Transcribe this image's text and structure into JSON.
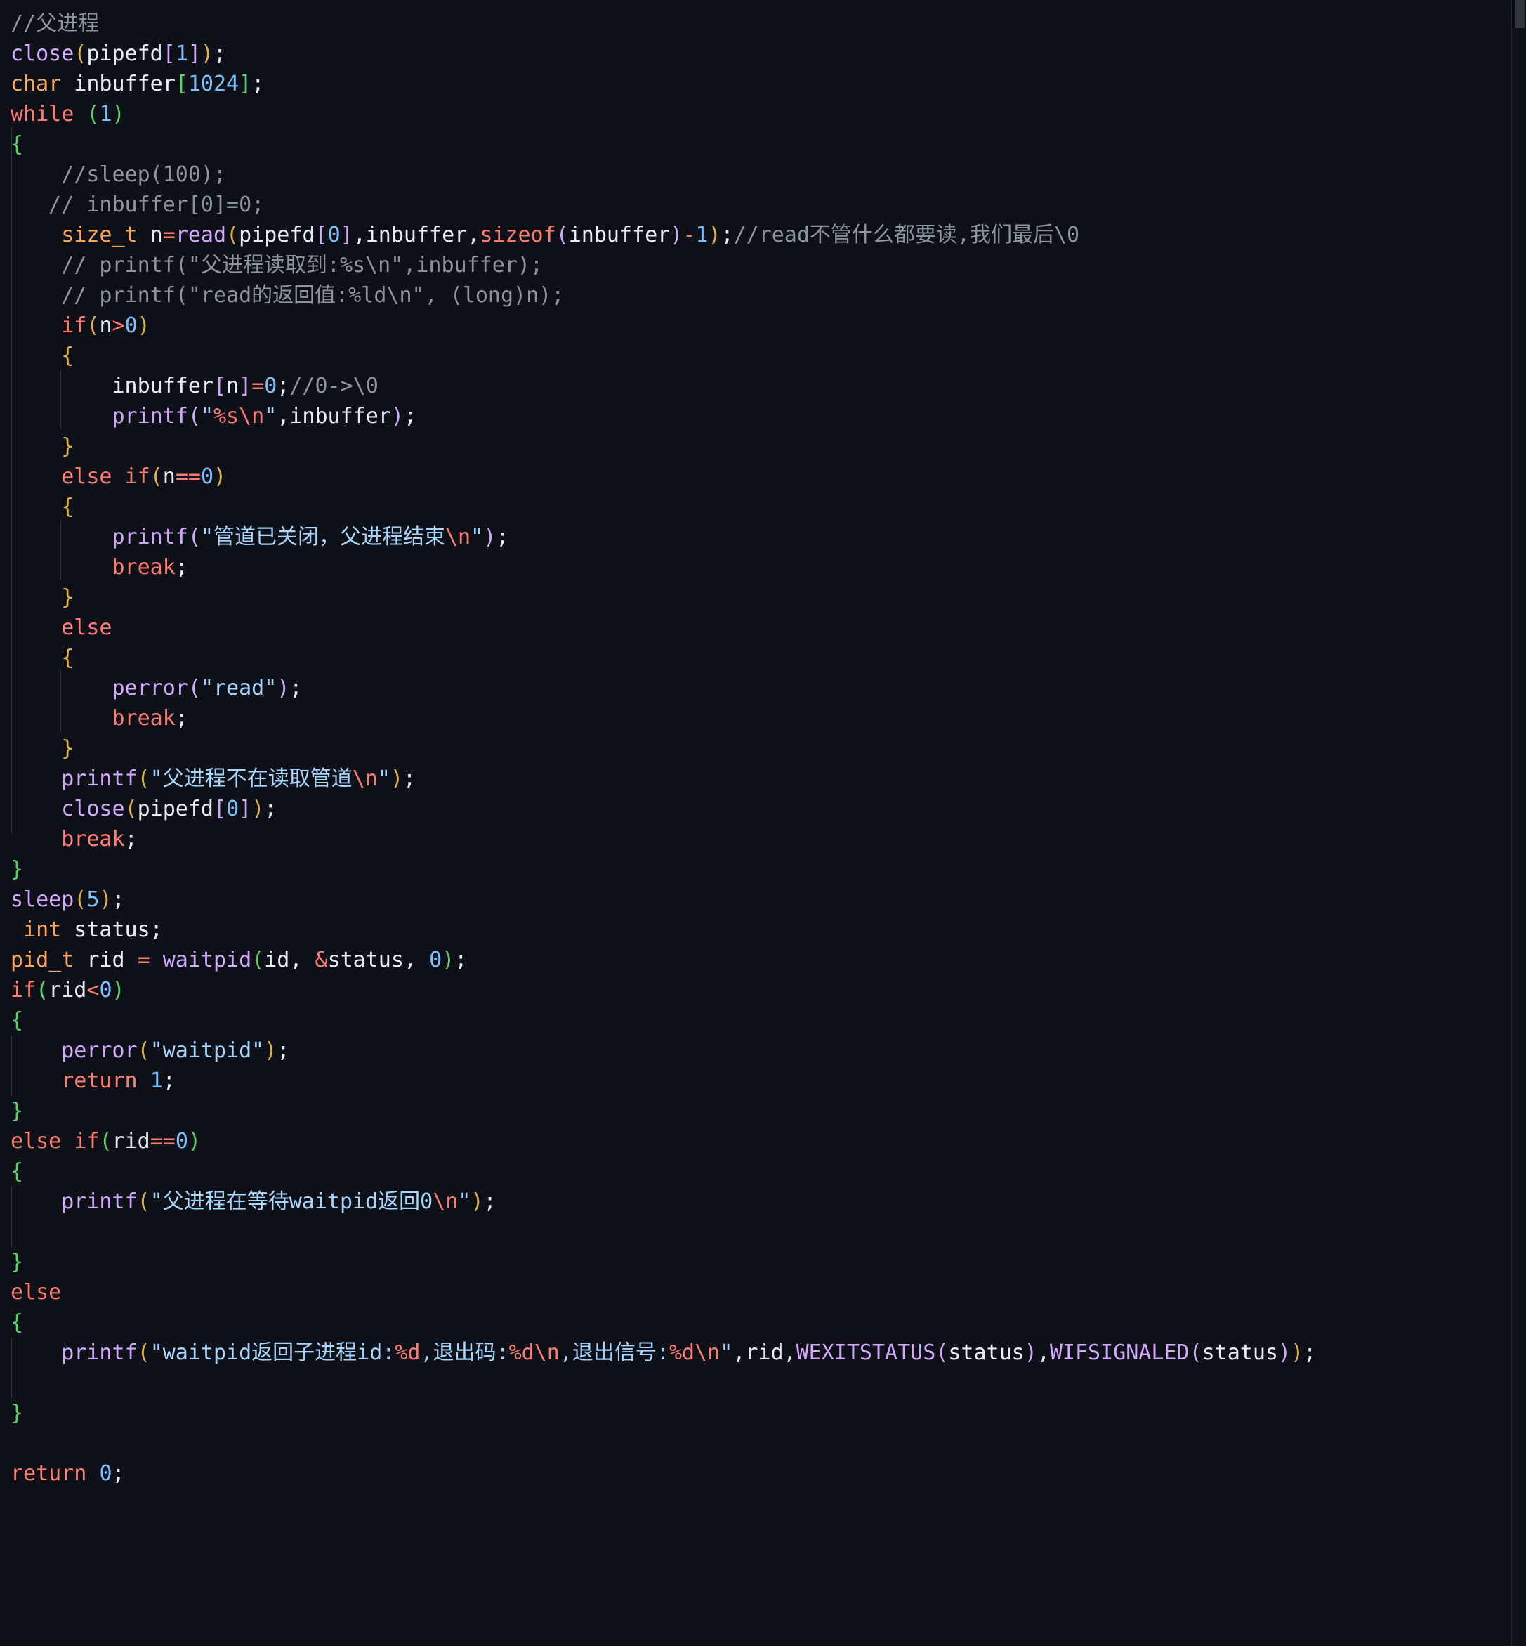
{
  "editor": {
    "language": "c",
    "lines": [
      [
        {
          "t": "//父进程",
          "c": "c"
        }
      ],
      [
        {
          "t": "close",
          "c": "f"
        },
        {
          "t": "(",
          "c": "p1"
        },
        {
          "t": "pipefd",
          "c": "v"
        },
        {
          "t": "[",
          "c": "p2"
        },
        {
          "t": "1",
          "c": "n"
        },
        {
          "t": "]",
          "c": "p2"
        },
        {
          "t": ")",
          "c": "p1"
        },
        {
          "t": ";",
          "c": "v"
        }
      ],
      [
        {
          "t": "char",
          "c": "t"
        },
        {
          "t": " inbuffer",
          "c": "v"
        },
        {
          "t": "[",
          "c": "pg"
        },
        {
          "t": "1024",
          "c": "n"
        },
        {
          "t": "]",
          "c": "pg"
        },
        {
          "t": ";",
          "c": "v"
        }
      ],
      [
        {
          "t": "while",
          "c": "k"
        },
        {
          "t": " ",
          "c": "v"
        },
        {
          "t": "(",
          "c": "pg"
        },
        {
          "t": "1",
          "c": "n"
        },
        {
          "t": ")",
          "c": "pg"
        }
      ],
      [
        {
          "t": "{",
          "c": "pg"
        }
      ],
      [
        {
          "t": "    //sleep(100);",
          "c": "c"
        }
      ],
      [
        {
          "t": "   // inbuffer[0]=0;",
          "c": "c"
        }
      ],
      [
        {
          "t": "    ",
          "c": "v"
        },
        {
          "t": "size_t",
          "c": "t"
        },
        {
          "t": " n",
          "c": "v"
        },
        {
          "t": "=",
          "c": "o"
        },
        {
          "t": "read",
          "c": "f"
        },
        {
          "t": "(",
          "c": "p1"
        },
        {
          "t": "pipefd",
          "c": "v"
        },
        {
          "t": "[",
          "c": "p2"
        },
        {
          "t": "0",
          "c": "n"
        },
        {
          "t": "]",
          "c": "p2"
        },
        {
          "t": ",inbuffer,",
          "c": "v"
        },
        {
          "t": "sizeof",
          "c": "k"
        },
        {
          "t": "(",
          "c": "p2"
        },
        {
          "t": "inbuffer",
          "c": "v"
        },
        {
          "t": ")",
          "c": "p2"
        },
        {
          "t": "-",
          "c": "o"
        },
        {
          "t": "1",
          "c": "n"
        },
        {
          "t": ")",
          "c": "p1"
        },
        {
          "t": ";",
          "c": "v"
        },
        {
          "t": "//read不管什么都要读,我们最后\\0",
          "c": "c"
        }
      ],
      [
        {
          "t": "    // printf(\"父进程读取到:%s\\n\",inbuffer);",
          "c": "c"
        }
      ],
      [
        {
          "t": "    // printf(\"read的返回值:%ld\\n\", (long)n);",
          "c": "c"
        }
      ],
      [
        {
          "t": "    ",
          "c": "v"
        },
        {
          "t": "if",
          "c": "k"
        },
        {
          "t": "(",
          "c": "p1"
        },
        {
          "t": "n",
          "c": "v"
        },
        {
          "t": ">",
          "c": "o"
        },
        {
          "t": "0",
          "c": "n"
        },
        {
          "t": ")",
          "c": "p1"
        }
      ],
      [
        {
          "t": "    ",
          "c": "v"
        },
        {
          "t": "{",
          "c": "p1"
        }
      ],
      [
        {
          "t": "        inbuffer",
          "c": "v"
        },
        {
          "t": "[",
          "c": "p2"
        },
        {
          "t": "n",
          "c": "v"
        },
        {
          "t": "]",
          "c": "p2"
        },
        {
          "t": "=",
          "c": "o"
        },
        {
          "t": "0",
          "c": "n"
        },
        {
          "t": ";",
          "c": "v"
        },
        {
          "t": "//0->\\0",
          "c": "c"
        }
      ],
      [
        {
          "t": "        ",
          "c": "v"
        },
        {
          "t": "printf",
          "c": "f"
        },
        {
          "t": "(",
          "c": "p2"
        },
        {
          "t": "\"",
          "c": "s"
        },
        {
          "t": "%s\\n",
          "c": "e"
        },
        {
          "t": "\"",
          "c": "s"
        },
        {
          "t": ",inbuffer",
          "c": "v"
        },
        {
          "t": ")",
          "c": "p2"
        },
        {
          "t": ";",
          "c": "v"
        }
      ],
      [
        {
          "t": "    ",
          "c": "v"
        },
        {
          "t": "}",
          "c": "p1"
        }
      ],
      [
        {
          "t": "    ",
          "c": "v"
        },
        {
          "t": "else",
          "c": "k"
        },
        {
          "t": " ",
          "c": "v"
        },
        {
          "t": "if",
          "c": "k"
        },
        {
          "t": "(",
          "c": "p1"
        },
        {
          "t": "n",
          "c": "v"
        },
        {
          "t": "==",
          "c": "o"
        },
        {
          "t": "0",
          "c": "n"
        },
        {
          "t": ")",
          "c": "p1"
        }
      ],
      [
        {
          "t": "    ",
          "c": "v"
        },
        {
          "t": "{",
          "c": "p1"
        }
      ],
      [
        {
          "t": "        ",
          "c": "v"
        },
        {
          "t": "printf",
          "c": "f"
        },
        {
          "t": "(",
          "c": "p2"
        },
        {
          "t": "\"管道已关闭，父进程结束",
          "c": "s"
        },
        {
          "t": "\\n",
          "c": "e"
        },
        {
          "t": "\"",
          "c": "s"
        },
        {
          "t": ")",
          "c": "p2"
        },
        {
          "t": ";",
          "c": "v"
        }
      ],
      [
        {
          "t": "        ",
          "c": "v"
        },
        {
          "t": "break",
          "c": "k"
        },
        {
          "t": ";",
          "c": "v"
        }
      ],
      [
        {
          "t": "    ",
          "c": "v"
        },
        {
          "t": "}",
          "c": "p1"
        }
      ],
      [
        {
          "t": "    ",
          "c": "v"
        },
        {
          "t": "else",
          "c": "k"
        }
      ],
      [
        {
          "t": "    ",
          "c": "v"
        },
        {
          "t": "{",
          "c": "p1"
        }
      ],
      [
        {
          "t": "        ",
          "c": "v"
        },
        {
          "t": "perror",
          "c": "f"
        },
        {
          "t": "(",
          "c": "p2"
        },
        {
          "t": "\"read\"",
          "c": "s"
        },
        {
          "t": ")",
          "c": "p2"
        },
        {
          "t": ";",
          "c": "v"
        }
      ],
      [
        {
          "t": "        ",
          "c": "v"
        },
        {
          "t": "break",
          "c": "k"
        },
        {
          "t": ";",
          "c": "v"
        }
      ],
      [
        {
          "t": "    ",
          "c": "v"
        },
        {
          "t": "}",
          "c": "p1"
        }
      ],
      [
        {
          "t": "    ",
          "c": "v"
        },
        {
          "t": "printf",
          "c": "f"
        },
        {
          "t": "(",
          "c": "p1"
        },
        {
          "t": "\"父进程不在读取管道",
          "c": "s"
        },
        {
          "t": "\\n",
          "c": "e"
        },
        {
          "t": "\"",
          "c": "s"
        },
        {
          "t": ")",
          "c": "p1"
        },
        {
          "t": ";",
          "c": "v"
        }
      ],
      [
        {
          "t": "    ",
          "c": "v"
        },
        {
          "t": "close",
          "c": "f"
        },
        {
          "t": "(",
          "c": "p1"
        },
        {
          "t": "pipefd",
          "c": "v"
        },
        {
          "t": "[",
          "c": "p2"
        },
        {
          "t": "0",
          "c": "n"
        },
        {
          "t": "]",
          "c": "p2"
        },
        {
          "t": ")",
          "c": "p1"
        },
        {
          "t": ";",
          "c": "v"
        }
      ],
      [
        {
          "t": "    ",
          "c": "v"
        },
        {
          "t": "break",
          "c": "k"
        },
        {
          "t": ";",
          "c": "v"
        }
      ],
      [
        {
          "t": "}",
          "c": "pg"
        }
      ],
      [
        {
          "t": "sleep",
          "c": "f"
        },
        {
          "t": "(",
          "c": "p1"
        },
        {
          "t": "5",
          "c": "n"
        },
        {
          "t": ")",
          "c": "p1"
        },
        {
          "t": ";",
          "c": "v"
        }
      ],
      [
        {
          "t": " ",
          "c": "v"
        },
        {
          "t": "int",
          "c": "t"
        },
        {
          "t": " status;",
          "c": "v"
        }
      ],
      [
        {
          "t": "pid_t",
          "c": "t"
        },
        {
          "t": " rid ",
          "c": "v"
        },
        {
          "t": "=",
          "c": "o"
        },
        {
          "t": " ",
          "c": "v"
        },
        {
          "t": "waitpid",
          "c": "f"
        },
        {
          "t": "(",
          "c": "pg"
        },
        {
          "t": "id, ",
          "c": "v"
        },
        {
          "t": "&",
          "c": "o"
        },
        {
          "t": "status, ",
          "c": "v"
        },
        {
          "t": "0",
          "c": "n"
        },
        {
          "t": ")",
          "c": "pg"
        },
        {
          "t": ";",
          "c": "v"
        }
      ],
      [
        {
          "t": "if",
          "c": "k"
        },
        {
          "t": "(",
          "c": "pg"
        },
        {
          "t": "rid",
          "c": "v"
        },
        {
          "t": "<",
          "c": "o"
        },
        {
          "t": "0",
          "c": "n"
        },
        {
          "t": ")",
          "c": "pg"
        }
      ],
      [
        {
          "t": "{",
          "c": "pg"
        }
      ],
      [
        {
          "t": "    ",
          "c": "v"
        },
        {
          "t": "perror",
          "c": "f"
        },
        {
          "t": "(",
          "c": "p1"
        },
        {
          "t": "\"waitpid\"",
          "c": "s"
        },
        {
          "t": ")",
          "c": "p1"
        },
        {
          "t": ";",
          "c": "v"
        }
      ],
      [
        {
          "t": "    ",
          "c": "v"
        },
        {
          "t": "return",
          "c": "k"
        },
        {
          "t": " ",
          "c": "v"
        },
        {
          "t": "1",
          "c": "n"
        },
        {
          "t": ";",
          "c": "v"
        }
      ],
      [
        {
          "t": "}",
          "c": "pg"
        }
      ],
      [
        {
          "t": "else",
          "c": "k"
        },
        {
          "t": " ",
          "c": "v"
        },
        {
          "t": "if",
          "c": "k"
        },
        {
          "t": "(",
          "c": "pg"
        },
        {
          "t": "rid",
          "c": "v"
        },
        {
          "t": "==",
          "c": "o"
        },
        {
          "t": "0",
          "c": "n"
        },
        {
          "t": ")",
          "c": "pg"
        }
      ],
      [
        {
          "t": "{",
          "c": "pg"
        }
      ],
      [
        {
          "t": "    ",
          "c": "v"
        },
        {
          "t": "printf",
          "c": "f"
        },
        {
          "t": "(",
          "c": "p1"
        },
        {
          "t": "\"父进程在等待waitpid返回0",
          "c": "s"
        },
        {
          "t": "\\n",
          "c": "e"
        },
        {
          "t": "\"",
          "c": "s"
        },
        {
          "t": ")",
          "c": "p1"
        },
        {
          "t": ";",
          "c": "v"
        }
      ],
      [
        {
          "t": "",
          "c": "v"
        }
      ],
      [
        {
          "t": "}",
          "c": "pg"
        }
      ],
      [
        {
          "t": "else",
          "c": "k"
        }
      ],
      [
        {
          "t": "{",
          "c": "pg"
        }
      ],
      [
        {
          "t": "    ",
          "c": "v"
        },
        {
          "t": "printf",
          "c": "f"
        },
        {
          "t": "(",
          "c": "p1"
        },
        {
          "t": "\"waitpid返回子进程id:",
          "c": "s"
        },
        {
          "t": "%d",
          "c": "e"
        },
        {
          "t": ",退出码:",
          "c": "s"
        },
        {
          "t": "%d\\n",
          "c": "e"
        },
        {
          "t": ",退出信号:",
          "c": "s"
        },
        {
          "t": "%d\\n",
          "c": "e"
        },
        {
          "t": "\"",
          "c": "s"
        },
        {
          "t": ",rid,",
          "c": "v"
        },
        {
          "t": "WEXITSTATUS",
          "c": "m"
        },
        {
          "t": "(",
          "c": "p2"
        },
        {
          "t": "status",
          "c": "v"
        },
        {
          "t": ")",
          "c": "p2"
        },
        {
          "t": ",",
          "c": "v"
        },
        {
          "t": "WIFSIGNALED",
          "c": "m"
        },
        {
          "t": "(",
          "c": "p2"
        },
        {
          "t": "status",
          "c": "v"
        },
        {
          "t": ")",
          "c": "p2"
        },
        {
          "t": ")",
          "c": "p1"
        },
        {
          "t": ";",
          "c": "v"
        }
      ],
      [
        {
          "t": "",
          "c": "v"
        }
      ],
      [
        {
          "t": "}",
          "c": "pg"
        }
      ],
      [
        {
          "t": "",
          "c": "v"
        }
      ],
      [
        {
          "t": "return",
          "c": "k"
        },
        {
          "t": " ",
          "c": "v"
        },
        {
          "t": "0",
          "c": "n"
        },
        {
          "t": ";",
          "c": "v"
        }
      ]
    ],
    "current_line": 1
  }
}
